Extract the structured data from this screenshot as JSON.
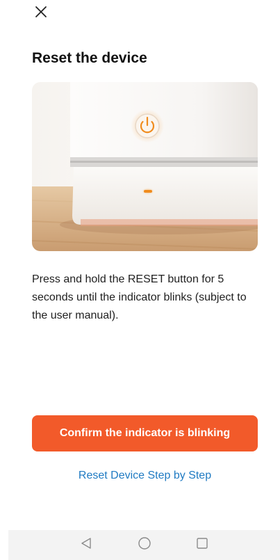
{
  "header": {
    "close_icon": "close-icon",
    "title": "Reset the device"
  },
  "illustration": {
    "icon": "device-photo",
    "accent_color": "#f0912a"
  },
  "main": {
    "instruction": "Press and hold the RESET button for 5 seconds until the indicator blinks (subject to the user manual).",
    "confirm_label": "Confirm the indicator is blinking",
    "help_link": "Reset Device Step by Step"
  },
  "colors": {
    "primary": "#f25a2a",
    "link": "#1f7ac2"
  },
  "navigation": {
    "back_icon": "back-triangle-icon",
    "home_icon": "home-circle-icon",
    "recent_icon": "recent-square-icon"
  }
}
